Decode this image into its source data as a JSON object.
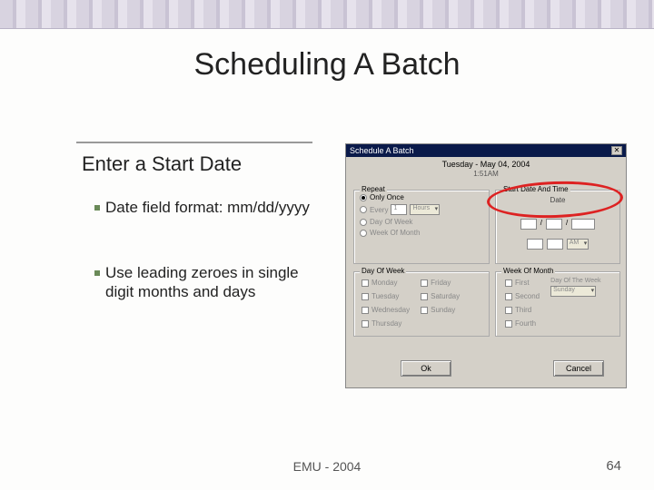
{
  "slide": {
    "title": "Scheduling A Batch",
    "subtitle": "Enter a Start Date",
    "bullets": [
      "Date field format: mm/dd/yyyy",
      "Use leading zeroes in single digit months and days"
    ],
    "footer": "EMU - 2004",
    "page_number": "64"
  },
  "dialog": {
    "title": "Schedule A Batch",
    "current_date": "Tuesday - May 04, 2004",
    "current_time": "1:51AM",
    "close_glyph": "✕",
    "repeat": {
      "legend": "Repeat",
      "only_once": "Only Once",
      "every": "Every",
      "every_value": "1",
      "every_unit": "Hours",
      "day_of_week": "Day Of Week",
      "week_of_month": "Week Of Month"
    },
    "start": {
      "legend": "Start Date And Time",
      "date_label": "Date",
      "sep": "/",
      "ampm": "AM"
    },
    "dow": {
      "legend": "Day Of Week",
      "days_col1": [
        "Monday",
        "Tuesday",
        "Wednesday",
        "Thursday"
      ],
      "days_col2": [
        "Friday",
        "Saturday",
        "Sunday"
      ]
    },
    "wom": {
      "legend": "Week Of Month",
      "weeks": [
        "First",
        "Second",
        "Third",
        "Fourth"
      ],
      "right_label": "Day Of The Week",
      "right_value": "Sunday"
    },
    "buttons": {
      "ok": "Ok",
      "cancel": "Cancel"
    }
  }
}
